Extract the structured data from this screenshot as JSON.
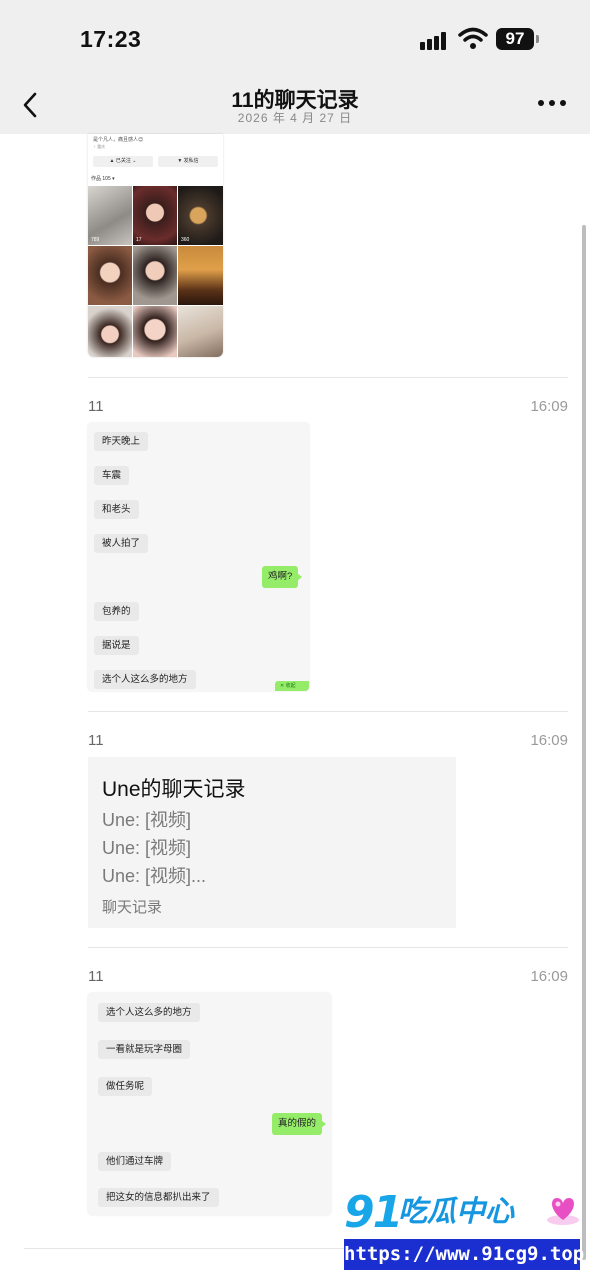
{
  "status_bar": {
    "time": "17:23",
    "battery": "97"
  },
  "nav": {
    "title": "11的聊天记录",
    "date": "2026 年 4 月 27 日"
  },
  "profile_card": {
    "bio": "是个凡人，痛且感人😊",
    "tags": "♀  重庆",
    "follow_button": "▲ 已关注 ⌄",
    "message_button": "▼ 发私信",
    "works_label": "作品 105 ▾",
    "like_counts": [
      "789",
      "17",
      "360",
      "",
      "",
      "",
      "",
      "",
      ""
    ]
  },
  "messages": [
    {
      "sender": "11",
      "time": "16:09",
      "chat_lines": [
        {
          "side": "left",
          "text": "昨天晚上"
        },
        {
          "side": "left",
          "text": "车震"
        },
        {
          "side": "left",
          "text": "和老头"
        },
        {
          "side": "left",
          "text": "被人拍了"
        },
        {
          "side": "right",
          "text": "鸡啊?"
        },
        {
          "side": "left",
          "text": "包养的"
        },
        {
          "side": "left",
          "text": "据说是"
        },
        {
          "side": "left",
          "text": "选个人这么多的地方"
        }
      ],
      "corner_text": "✕ 收起"
    },
    {
      "sender": "11",
      "time": "16:09",
      "record": {
        "title": "Une的聊天记录",
        "lines": [
          "Une: [视频]",
          "Une: [视频]",
          "Une: [视频]..."
        ],
        "footer": "聊天记录"
      }
    },
    {
      "sender": "11",
      "time": "16:09",
      "chat_lines": [
        {
          "side": "left",
          "text": "选个人这么多的地方"
        },
        {
          "side": "left",
          "text": "一看就是玩字母圈"
        },
        {
          "side": "left",
          "text": "做任务呢"
        },
        {
          "side": "right",
          "text": "真的假的"
        },
        {
          "side": "left",
          "text": "他们通过车牌"
        },
        {
          "side": "left",
          "text": "把这女的信息都扒出来了"
        }
      ]
    }
  ],
  "watermark": {
    "logo_number": "91",
    "logo_name": "吃瓜中心",
    "url": "https://www.91cg9.top"
  },
  "colors": {
    "bubble_green": "#95ec69",
    "watermark_blue": "#1b2fd1"
  }
}
